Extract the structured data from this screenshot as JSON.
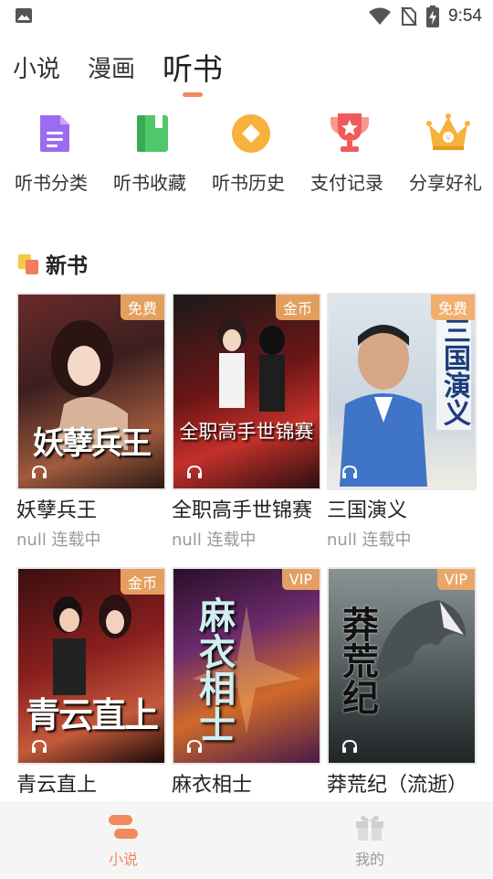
{
  "status": {
    "time": "9:54"
  },
  "tabs": [
    {
      "label": "小说",
      "active": false
    },
    {
      "label": "漫画",
      "active": false
    },
    {
      "label": "听书",
      "active": true
    }
  ],
  "categories": [
    {
      "label": "听书分类",
      "icon": "document-icon",
      "color": "#9b6cf0"
    },
    {
      "label": "听书收藏",
      "icon": "bookmark-book-icon",
      "color": "#4fc86a"
    },
    {
      "label": "听书历史",
      "icon": "history-diamond-icon",
      "color": "#f6b23c"
    },
    {
      "label": "支付记录",
      "icon": "trophy-icon",
      "color": "#f05a5a"
    },
    {
      "label": "分享好礼",
      "icon": "crown-icon",
      "color": "#f6b23c"
    }
  ],
  "section": {
    "title": "新书"
  },
  "books": [
    {
      "title": "妖孽兵王",
      "subtitle": "null 连载中",
      "badge": "免费",
      "cover_text": "妖孽兵王"
    },
    {
      "title": "全职高手世锦赛",
      "subtitle": "null 连载中",
      "badge": "金币",
      "cover_text": "全职高手世锦赛"
    },
    {
      "title": "三国演义",
      "subtitle": "null 连载中",
      "badge": "免费",
      "cover_text": "三国演义"
    },
    {
      "title": "青云直上",
      "subtitle": "",
      "badge": "金币",
      "cover_text": "青云直上"
    },
    {
      "title": "麻衣相士",
      "subtitle": "",
      "badge": "VIP",
      "cover_text": "麻衣相士"
    },
    {
      "title": "莽荒纪（流逝）",
      "subtitle": "",
      "badge": "VIP",
      "cover_text": "莽荒纪"
    }
  ],
  "nav": [
    {
      "label": "小说",
      "icon": "novel-icon",
      "active": true
    },
    {
      "label": "我的",
      "icon": "gift-icon",
      "active": false
    }
  ],
  "colors": {
    "accent": "#f08a5d",
    "nav_inactive": "#999999"
  }
}
